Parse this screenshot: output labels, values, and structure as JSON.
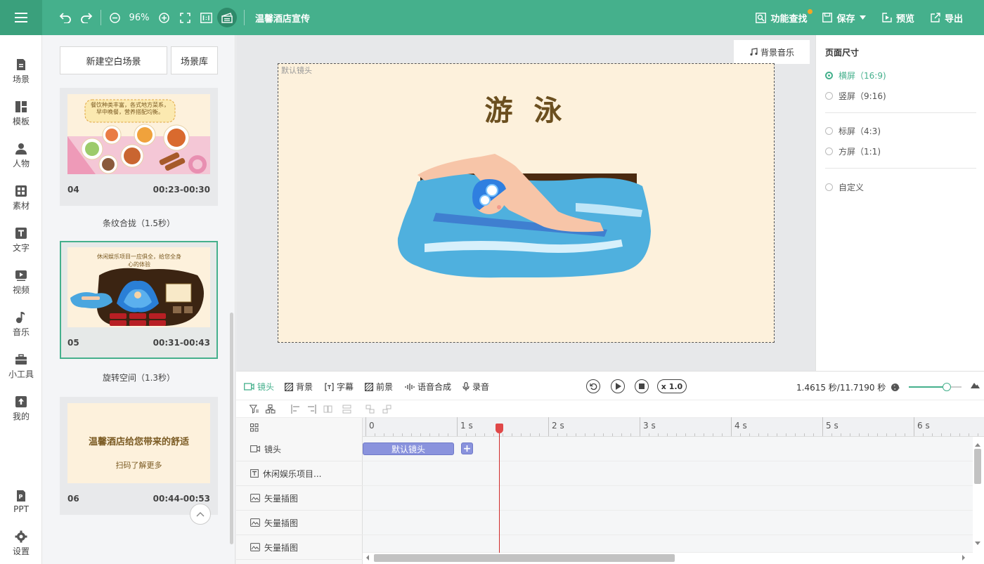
{
  "toolbar": {
    "zoom": "96%",
    "project_title": "温馨酒店宣传",
    "find_label": "功能查找",
    "save_label": "保存",
    "preview_label": "预览",
    "export_label": "导出"
  },
  "nav": {
    "items": [
      {
        "label": "场景",
        "icon": "scene-icon"
      },
      {
        "label": "模板",
        "icon": "template-icon"
      },
      {
        "label": "人物",
        "icon": "person-icon"
      },
      {
        "label": "素材",
        "icon": "material-icon"
      },
      {
        "label": "文字",
        "icon": "text-icon"
      },
      {
        "label": "视频",
        "icon": "video-icon"
      },
      {
        "label": "音乐",
        "icon": "music-icon"
      },
      {
        "label": "小工具",
        "icon": "toolbox-icon"
      },
      {
        "label": "我的",
        "icon": "upload-icon"
      }
    ],
    "bottom": [
      {
        "label": "PPT",
        "icon": "ppt-icon"
      },
      {
        "label": "设置",
        "icon": "gear-icon"
      }
    ]
  },
  "scenes_panel": {
    "new_blank_label": "新建空白场景",
    "library_label": "场景库",
    "scenes": [
      {
        "num": "04",
        "time": "00:23-00:30",
        "transition": "条纹合拢（1.5秒）",
        "thumb_text": "餐饮种类丰富，各式地方菜系，早中晚餐，营养搭配均衡。"
      },
      {
        "num": "05",
        "time": "00:31-00:43",
        "transition": "旋转空间（1.3秒）",
        "thumb_text": "休闲娱乐项目一应俱全，给您全身心的体验"
      },
      {
        "num": "06",
        "time": "00:44-00:53",
        "transition": "",
        "thumb_text": "温馨酒店给您带来的舒适",
        "thumb_sub": "扫码了解更多"
      }
    ]
  },
  "canvas": {
    "bg_music_label": "背景音乐",
    "lens_label": "默认镜头",
    "title": "游 泳"
  },
  "props": {
    "title": "页面尺寸",
    "options": [
      {
        "label": "横屏（16:9)",
        "selected": true
      },
      {
        "label": "竖屏（9:16)",
        "selected": false
      },
      {
        "label": "标屏（4:3)",
        "selected": false
      },
      {
        "label": "方屏（1:1)",
        "selected": false
      },
      {
        "label": "自定义",
        "selected": false
      }
    ]
  },
  "timeline": {
    "tabs": [
      {
        "label": "镜头",
        "icon": "camera-icon",
        "active": true
      },
      {
        "label": "背景",
        "icon": "background-icon",
        "active": false
      },
      {
        "label": "字幕",
        "icon": "subtitle-icon",
        "active": false
      },
      {
        "label": "前景",
        "icon": "foreground-icon",
        "active": false
      },
      {
        "label": "语音合成",
        "icon": "voice-icon",
        "active": false
      },
      {
        "label": "录音",
        "icon": "mic-icon",
        "active": false
      }
    ],
    "speed": "x 1.0",
    "time_readout": "1.4615 秒/11.7190 秒",
    "zoom_level": 0.72,
    "ruler": [
      "0",
      "1 s",
      "2 s",
      "3 s",
      "4 s",
      "5 s",
      "6 s"
    ],
    "tracks": [
      {
        "label": "镜头",
        "icon": "camera-icon"
      },
      {
        "label": "休闲娱乐项目...",
        "icon": "text-icon"
      },
      {
        "label": "矢量插图",
        "icon": "image-icon"
      },
      {
        "label": "矢量插图",
        "icon": "image-icon"
      },
      {
        "label": "矢量插图",
        "icon": "image-icon"
      }
    ],
    "clip_label": "默认镜头",
    "clip_add": "+",
    "playhead_time": 1.4615
  },
  "colors": {
    "brand": "#45b08c",
    "clip": "#8a93dd",
    "playhead": "#d02a2a"
  }
}
